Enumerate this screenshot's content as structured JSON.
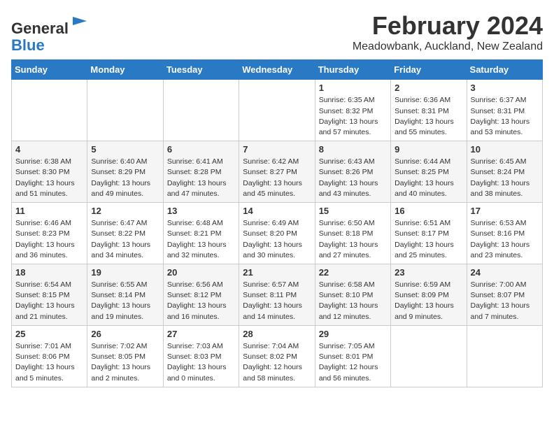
{
  "header": {
    "logo_line1": "General",
    "logo_line2": "Blue",
    "month": "February 2024",
    "location": "Meadowbank, Auckland, New Zealand"
  },
  "weekdays": [
    "Sunday",
    "Monday",
    "Tuesday",
    "Wednesday",
    "Thursday",
    "Friday",
    "Saturday"
  ],
  "weeks": [
    [
      {
        "day": "",
        "info": ""
      },
      {
        "day": "",
        "info": ""
      },
      {
        "day": "",
        "info": ""
      },
      {
        "day": "",
        "info": ""
      },
      {
        "day": "1",
        "info": "Sunrise: 6:35 AM\nSunset: 8:32 PM\nDaylight: 13 hours\nand 57 minutes."
      },
      {
        "day": "2",
        "info": "Sunrise: 6:36 AM\nSunset: 8:31 PM\nDaylight: 13 hours\nand 55 minutes."
      },
      {
        "day": "3",
        "info": "Sunrise: 6:37 AM\nSunset: 8:31 PM\nDaylight: 13 hours\nand 53 minutes."
      }
    ],
    [
      {
        "day": "4",
        "info": "Sunrise: 6:38 AM\nSunset: 8:30 PM\nDaylight: 13 hours\nand 51 minutes."
      },
      {
        "day": "5",
        "info": "Sunrise: 6:40 AM\nSunset: 8:29 PM\nDaylight: 13 hours\nand 49 minutes."
      },
      {
        "day": "6",
        "info": "Sunrise: 6:41 AM\nSunset: 8:28 PM\nDaylight: 13 hours\nand 47 minutes."
      },
      {
        "day": "7",
        "info": "Sunrise: 6:42 AM\nSunset: 8:27 PM\nDaylight: 13 hours\nand 45 minutes."
      },
      {
        "day": "8",
        "info": "Sunrise: 6:43 AM\nSunset: 8:26 PM\nDaylight: 13 hours\nand 43 minutes."
      },
      {
        "day": "9",
        "info": "Sunrise: 6:44 AM\nSunset: 8:25 PM\nDaylight: 13 hours\nand 40 minutes."
      },
      {
        "day": "10",
        "info": "Sunrise: 6:45 AM\nSunset: 8:24 PM\nDaylight: 13 hours\nand 38 minutes."
      }
    ],
    [
      {
        "day": "11",
        "info": "Sunrise: 6:46 AM\nSunset: 8:23 PM\nDaylight: 13 hours\nand 36 minutes."
      },
      {
        "day": "12",
        "info": "Sunrise: 6:47 AM\nSunset: 8:22 PM\nDaylight: 13 hours\nand 34 minutes."
      },
      {
        "day": "13",
        "info": "Sunrise: 6:48 AM\nSunset: 8:21 PM\nDaylight: 13 hours\nand 32 minutes."
      },
      {
        "day": "14",
        "info": "Sunrise: 6:49 AM\nSunset: 8:20 PM\nDaylight: 13 hours\nand 30 minutes."
      },
      {
        "day": "15",
        "info": "Sunrise: 6:50 AM\nSunset: 8:18 PM\nDaylight: 13 hours\nand 27 minutes."
      },
      {
        "day": "16",
        "info": "Sunrise: 6:51 AM\nSunset: 8:17 PM\nDaylight: 13 hours\nand 25 minutes."
      },
      {
        "day": "17",
        "info": "Sunrise: 6:53 AM\nSunset: 8:16 PM\nDaylight: 13 hours\nand 23 minutes."
      }
    ],
    [
      {
        "day": "18",
        "info": "Sunrise: 6:54 AM\nSunset: 8:15 PM\nDaylight: 13 hours\nand 21 minutes."
      },
      {
        "day": "19",
        "info": "Sunrise: 6:55 AM\nSunset: 8:14 PM\nDaylight: 13 hours\nand 19 minutes."
      },
      {
        "day": "20",
        "info": "Sunrise: 6:56 AM\nSunset: 8:12 PM\nDaylight: 13 hours\nand 16 minutes."
      },
      {
        "day": "21",
        "info": "Sunrise: 6:57 AM\nSunset: 8:11 PM\nDaylight: 13 hours\nand 14 minutes."
      },
      {
        "day": "22",
        "info": "Sunrise: 6:58 AM\nSunset: 8:10 PM\nDaylight: 13 hours\nand 12 minutes."
      },
      {
        "day": "23",
        "info": "Sunrise: 6:59 AM\nSunset: 8:09 PM\nDaylight: 13 hours\nand 9 minutes."
      },
      {
        "day": "24",
        "info": "Sunrise: 7:00 AM\nSunset: 8:07 PM\nDaylight: 13 hours\nand 7 minutes."
      }
    ],
    [
      {
        "day": "25",
        "info": "Sunrise: 7:01 AM\nSunset: 8:06 PM\nDaylight: 13 hours\nand 5 minutes."
      },
      {
        "day": "26",
        "info": "Sunrise: 7:02 AM\nSunset: 8:05 PM\nDaylight: 13 hours\nand 2 minutes."
      },
      {
        "day": "27",
        "info": "Sunrise: 7:03 AM\nSunset: 8:03 PM\nDaylight: 13 hours\nand 0 minutes."
      },
      {
        "day": "28",
        "info": "Sunrise: 7:04 AM\nSunset: 8:02 PM\nDaylight: 12 hours\nand 58 minutes."
      },
      {
        "day": "29",
        "info": "Sunrise: 7:05 AM\nSunset: 8:01 PM\nDaylight: 12 hours\nand 56 minutes."
      },
      {
        "day": "",
        "info": ""
      },
      {
        "day": "",
        "info": ""
      }
    ]
  ]
}
